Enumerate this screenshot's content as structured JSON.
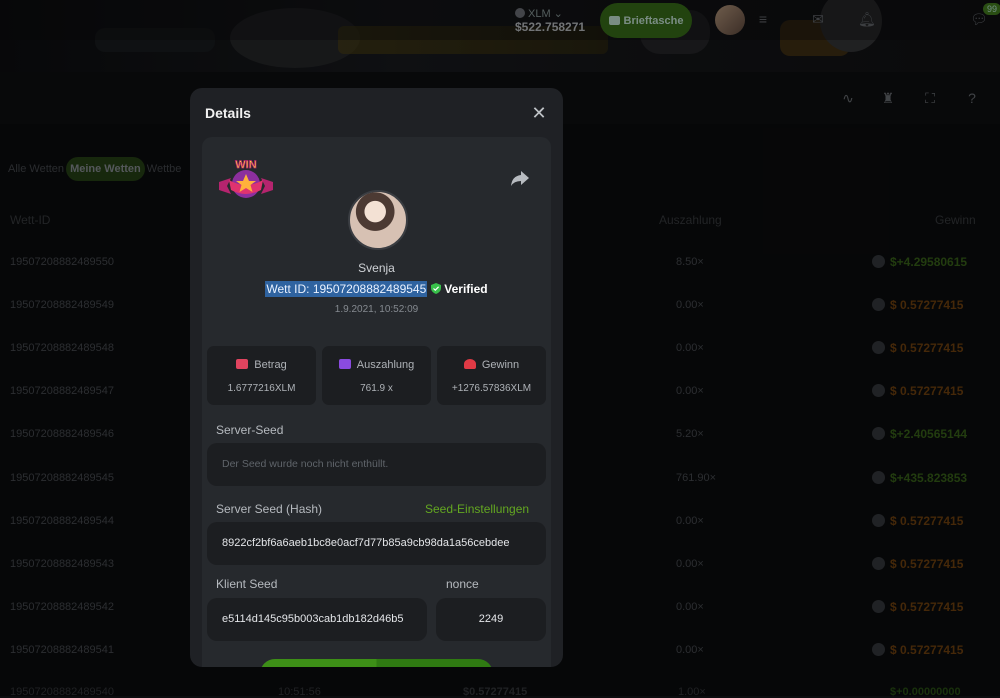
{
  "header": {
    "currency": "XLM",
    "balance": "$522.758271",
    "wallet_label": "Brieftasche",
    "chat_badge": "99"
  },
  "filters": {
    "tabs": [
      "Alle Wetten",
      "Meine Wetten",
      "Wettbe"
    ],
    "active": "Meine Wetten"
  },
  "table": {
    "headers": {
      "id": "Wett-ID",
      "payout": "Auszahlung",
      "win": "Gewinn"
    },
    "rows": [
      {
        "id": "19507208882489550",
        "payout": "8.50×",
        "win": "$+4.29580615",
        "sign": "pos"
      },
      {
        "id": "19507208882489549",
        "payout": "0.00×",
        "win": "$  0.57277415",
        "sign": "neg"
      },
      {
        "id": "19507208882489548",
        "payout": "0.00×",
        "win": "$  0.57277415",
        "sign": "neg"
      },
      {
        "id": "19507208882489547",
        "payout": "0.00×",
        "win": "$  0.57277415",
        "sign": "neg"
      },
      {
        "id": "19507208882489546",
        "payout": "5.20×",
        "win": "$+2.40565144",
        "sign": "pos"
      },
      {
        "id": "19507208882489545",
        "payout": "761.90×",
        "win": "$+435.823853",
        "sign": "pos"
      },
      {
        "id": "19507208882489544",
        "payout": "0.00×",
        "win": "$  0.57277415",
        "sign": "neg"
      },
      {
        "id": "19507208882489543",
        "payout": "0.00×",
        "win": "$  0.57277415",
        "sign": "neg"
      },
      {
        "id": "19507208882489542",
        "payout": "0.00×",
        "win": "$  0.57277415",
        "sign": "neg"
      },
      {
        "id": "19507208882489541",
        "payout": "0.00×",
        "win": "$  0.57277415",
        "sign": "neg"
      }
    ],
    "partial_row": {
      "id": "19507208882489540",
      "time": "10:51:56",
      "amount": "$0.57277415",
      "payout": "1.00×",
      "win": "$+0.00000000"
    }
  },
  "modal": {
    "title": "Details",
    "username": "Svenja",
    "bet_id": "Wett ID: 19507208882489545",
    "verified": "Verified",
    "datetime": "1.9.2021, 10:52:09",
    "stats": [
      {
        "label": "Betrag",
        "value": "1.6777216XLM",
        "color": "#e0445f"
      },
      {
        "label": "Auszahlung",
        "value": "761.9 x",
        "color": "#8a4be0"
      },
      {
        "label": "Gewinn",
        "value": "+1276.57836XLM",
        "color": "#e03a45"
      }
    ],
    "server_seed_label": "Server-Seed",
    "server_seed_placeholder": "Der Seed wurde noch nicht enthüllt.",
    "server_seed_hash_label": "Server Seed (Hash)",
    "seed_settings_link": "Seed-Einstellungen",
    "server_seed_hash": "8922cf2bf6a6aeb1bc8e0acf7d77b85a9cb98da1a56cebdee",
    "client_seed_label": "Klient Seed",
    "client_seed": "e5114d145c95b003cab1db182d46b5",
    "nonce_label": "nonce",
    "nonce": "2249"
  },
  "colors": {
    "accent": "#63a721",
    "win_positive": "#4b8a1f",
    "win_negative": "#b56612",
    "selection": "#2f63a0"
  }
}
